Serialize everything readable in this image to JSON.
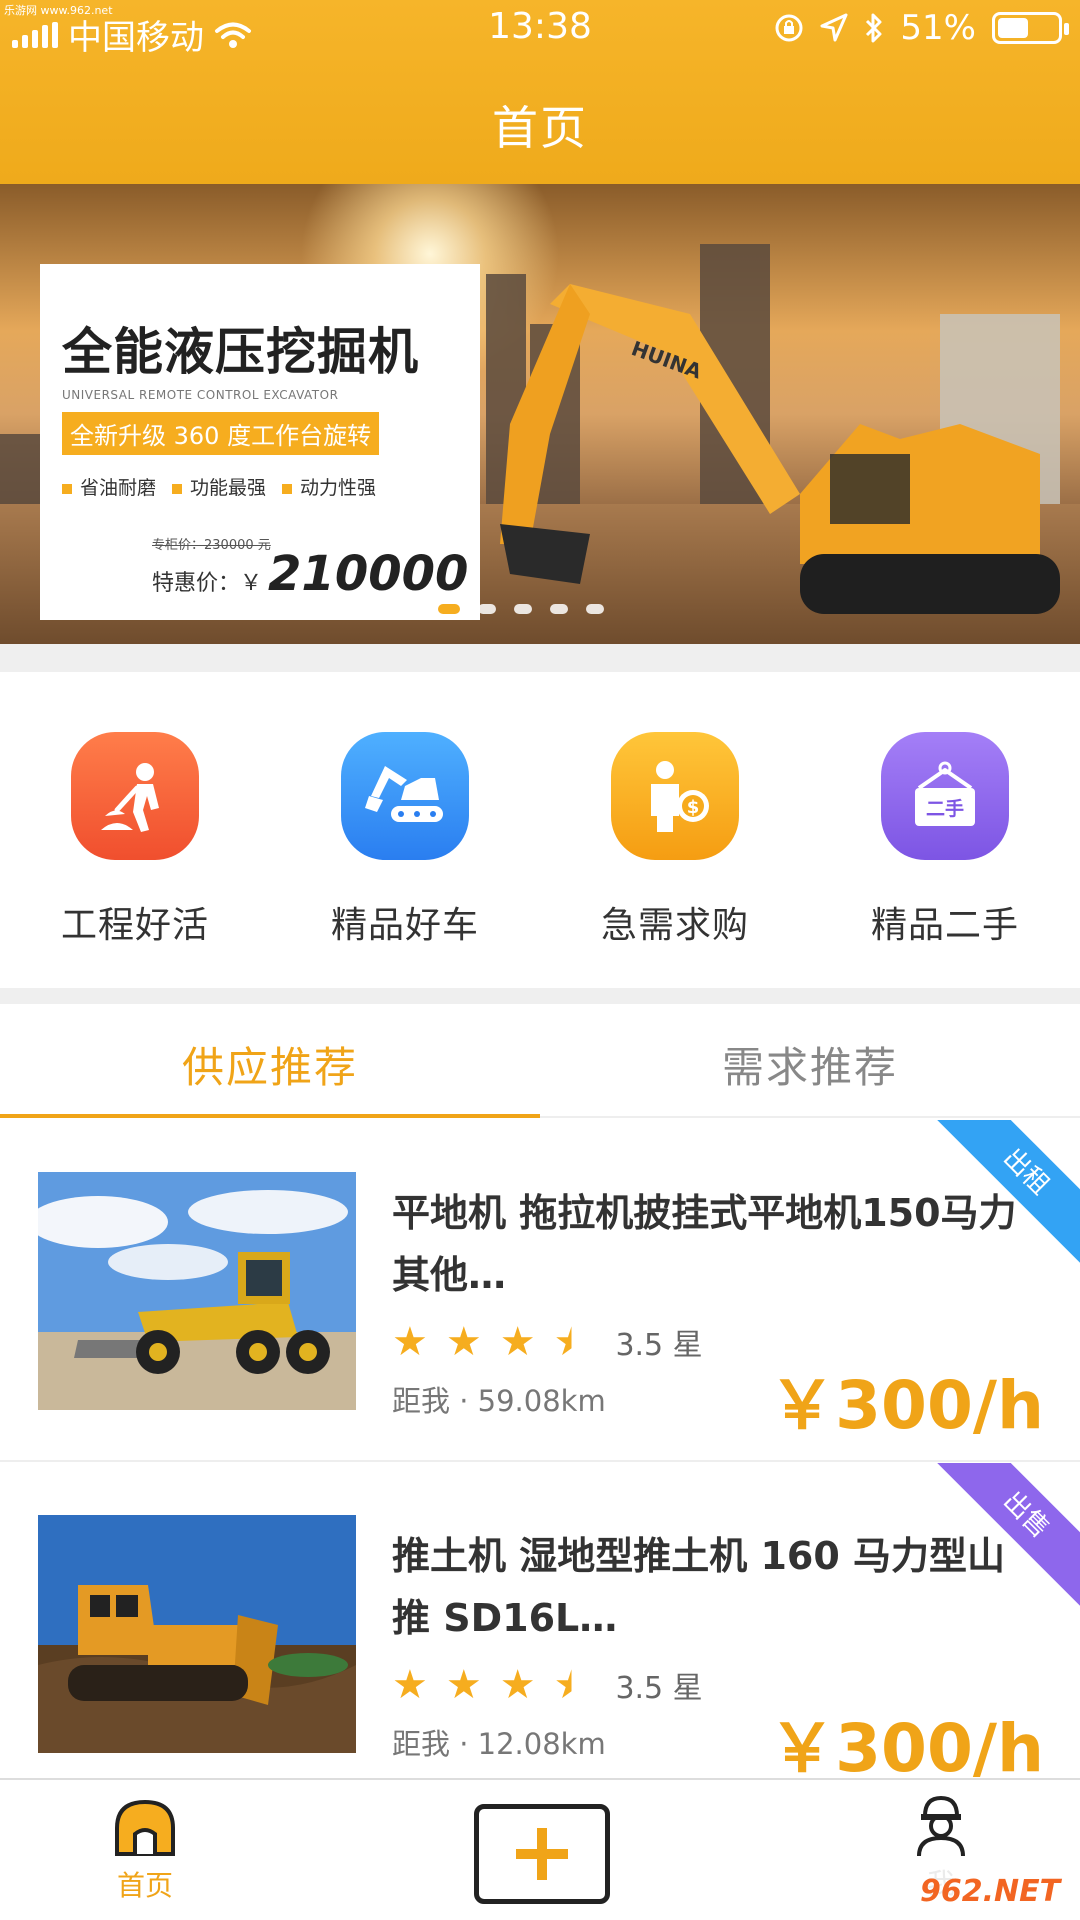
{
  "watermark_top": "乐游网 www.962.net",
  "status": {
    "carrier": "中国移动",
    "time": "13:38",
    "battery_pct": "51%",
    "battery_level": 0.51
  },
  "nav": {
    "title": "首页"
  },
  "banner": {
    "title": "全能液压挖掘机",
    "subtitle_en": "UNIVERSAL REMOTE CONTROL EXCAVATOR",
    "upgrade": "全新升级 360 度工作台旋转",
    "features": [
      "省油耐磨",
      "功能最强",
      "动力性强"
    ],
    "old_price": "专柜价：230000 元",
    "price_label": "特惠价：￥",
    "price": "210000",
    "brand": "HUINA",
    "active_dot": 0,
    "dot_count": 5
  },
  "categories": [
    {
      "label": "工程好活",
      "icon": "worker-digging-icon",
      "color": "#f4613a"
    },
    {
      "label": "精品好车",
      "icon": "excavator-icon",
      "color": "#2f8ff5"
    },
    {
      "label": "急需求购",
      "icon": "buyer-coin-icon",
      "color": "#f7ab1d"
    },
    {
      "label": "精品二手",
      "icon": "secondhand-sign-icon",
      "color": "#8e67ec",
      "icon_text": "二手"
    }
  ],
  "tabs": [
    {
      "label": "供应推荐",
      "active": true
    },
    {
      "label": "需求推荐",
      "active": false
    }
  ],
  "listings": [
    {
      "title": "平地机 拖拉机披挂式平地机150马力其他…",
      "rating": 3.5,
      "rating_text": "3.5 星",
      "distance": "距我 · 59.08km",
      "price": "￥300/h",
      "tag": "出租",
      "tag_color": "#33a3f4"
    },
    {
      "title": "推土机 湿地型推土机 160 马力型山推 SD16L…",
      "rating": 3.5,
      "rating_text": "3.5 星",
      "distance": "距我 · 12.08km",
      "price": "￥300/h",
      "tag": "出售",
      "tag_color": "#8e67ec"
    }
  ],
  "tabbar": {
    "home": "首页",
    "me": "我"
  },
  "watermark_bottom": "962.NET",
  "colors": {
    "accent": "#f0a418",
    "header": "#f6b52a"
  }
}
